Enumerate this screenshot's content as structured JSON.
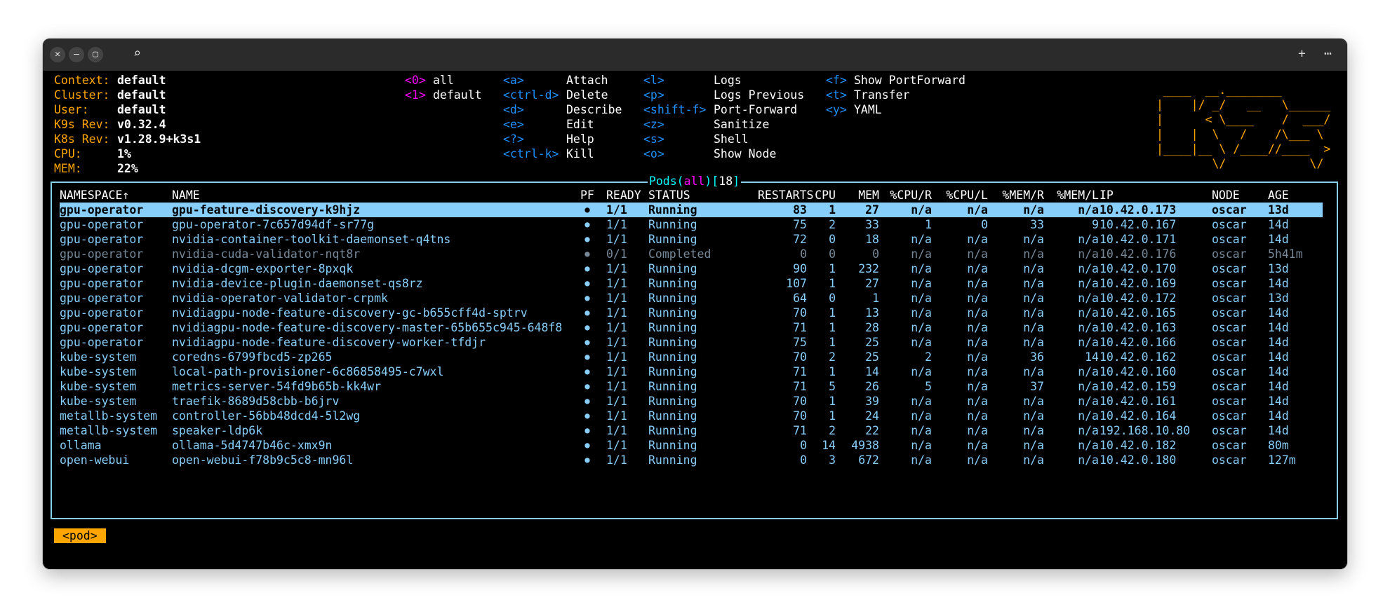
{
  "titlebar": {
    "close_icon": "close-icon",
    "minimize_icon": "minimize-icon",
    "maximize_icon": "maximize-icon",
    "search_icon": "search-icon",
    "new_tab_icon": "plus-icon",
    "menu_icon": "more-icon"
  },
  "info": [
    {
      "label": "Context:",
      "value": "default"
    },
    {
      "label": "Cluster:",
      "value": "default"
    },
    {
      "label": "User:",
      "value": "default"
    },
    {
      "label": "K9s Rev:",
      "value": "v0.32.4"
    },
    {
      "label": "K8s Rev:",
      "value": "v1.28.9+k3s1"
    },
    {
      "label": "CPU:",
      "value": "1%"
    },
    {
      "label": "MEM:",
      "value": "22%"
    }
  ],
  "namespaces": [
    {
      "key": "<0>",
      "label": "all"
    },
    {
      "key": "<1>",
      "label": "default"
    }
  ],
  "hotkeys_col1": [
    {
      "key": "<a>",
      "label": "Attach"
    },
    {
      "key": "<ctrl-d>",
      "label": "Delete"
    },
    {
      "key": "<d>",
      "label": "Describe"
    },
    {
      "key": "<e>",
      "label": "Edit"
    },
    {
      "key": "<?>",
      "label": "Help"
    },
    {
      "key": "<ctrl-k>",
      "label": "Kill"
    }
  ],
  "hotkeys_col2": [
    {
      "key": "<l>",
      "label": "Logs"
    },
    {
      "key": "<p>",
      "label": "Logs Previous"
    },
    {
      "key": "<shift-f>",
      "label": "Port-Forward"
    },
    {
      "key": "<z>",
      "label": "Sanitize"
    },
    {
      "key": "<s>",
      "label": "Shell"
    },
    {
      "key": "<o>",
      "label": "Show Node"
    }
  ],
  "hotkeys_col3": [
    {
      "key": "<f>",
      "label": "Show PortForward"
    },
    {
      "key": "<t>",
      "label": "Transfer"
    },
    {
      "key": "<y>",
      "label": "YAML"
    }
  ],
  "logo_lines": [
    " ____  __.________        ",
    "|    |/ _/   __   \\______ ",
    "|      < \\____    /  ___/ ",
    "|    |  \\   /    /\\___ \\  ",
    "|____|__ \\ /____//____  > ",
    "        \\/            \\/  "
  ],
  "pods": {
    "title_resource": "Pods",
    "title_namespace": "all",
    "title_count": "18",
    "columns": [
      "NAMESPACE↑",
      "NAME",
      "PF",
      "READY",
      "STATUS",
      "RESTARTS",
      "CPU",
      "MEM",
      "%CPU/R",
      "%CPU/L",
      "%MEM/R",
      "%MEM/L",
      "IP",
      "NODE",
      "AGE"
    ],
    "rows": [
      [
        "gpu-operator",
        "gpu-feature-discovery-k9hjz",
        "●",
        "1/1",
        "Running",
        "83",
        "1",
        "27",
        "n/a",
        "n/a",
        "n/a",
        "n/a",
        "10.42.0.173",
        "oscar",
        "13d"
      ],
      [
        "gpu-operator",
        "gpu-operator-7c657d94df-sr77g",
        "●",
        "1/1",
        "Running",
        "75",
        "2",
        "33",
        "1",
        "0",
        "33",
        "9",
        "10.42.0.167",
        "oscar",
        "14d"
      ],
      [
        "gpu-operator",
        "nvidia-container-toolkit-daemonset-q4tns",
        "●",
        "1/1",
        "Running",
        "72",
        "0",
        "18",
        "n/a",
        "n/a",
        "n/a",
        "n/a",
        "10.42.0.171",
        "oscar",
        "14d"
      ],
      [
        "gpu-operator",
        "nvidia-cuda-validator-nqt8r",
        "●",
        "0/1",
        "Completed",
        "0",
        "0",
        "0",
        "n/a",
        "n/a",
        "n/a",
        "n/a",
        "10.42.0.176",
        "oscar",
        "5h41m"
      ],
      [
        "gpu-operator",
        "nvidia-dcgm-exporter-8pxqk",
        "●",
        "1/1",
        "Running",
        "90",
        "1",
        "232",
        "n/a",
        "n/a",
        "n/a",
        "n/a",
        "10.42.0.170",
        "oscar",
        "13d"
      ],
      [
        "gpu-operator",
        "nvidia-device-plugin-daemonset-qs8rz",
        "●",
        "1/1",
        "Running",
        "107",
        "1",
        "27",
        "n/a",
        "n/a",
        "n/a",
        "n/a",
        "10.42.0.169",
        "oscar",
        "14d"
      ],
      [
        "gpu-operator",
        "nvidia-operator-validator-crpmk",
        "●",
        "1/1",
        "Running",
        "64",
        "0",
        "1",
        "n/a",
        "n/a",
        "n/a",
        "n/a",
        "10.42.0.172",
        "oscar",
        "13d"
      ],
      [
        "gpu-operator",
        "nvidiagpu-node-feature-discovery-gc-b655cff4d-sptrv",
        "●",
        "1/1",
        "Running",
        "70",
        "1",
        "13",
        "n/a",
        "n/a",
        "n/a",
        "n/a",
        "10.42.0.165",
        "oscar",
        "14d"
      ],
      [
        "gpu-operator",
        "nvidiagpu-node-feature-discovery-master-65b655c945-648f8",
        "●",
        "1/1",
        "Running",
        "71",
        "1",
        "28",
        "n/a",
        "n/a",
        "n/a",
        "n/a",
        "10.42.0.163",
        "oscar",
        "14d"
      ],
      [
        "gpu-operator",
        "nvidiagpu-node-feature-discovery-worker-tfdjr",
        "●",
        "1/1",
        "Running",
        "75",
        "1",
        "25",
        "n/a",
        "n/a",
        "n/a",
        "n/a",
        "10.42.0.166",
        "oscar",
        "14d"
      ],
      [
        "kube-system",
        "coredns-6799fbcd5-zp265",
        "●",
        "1/1",
        "Running",
        "70",
        "2",
        "25",
        "2",
        "n/a",
        "36",
        "14",
        "10.42.0.162",
        "oscar",
        "14d"
      ],
      [
        "kube-system",
        "local-path-provisioner-6c86858495-c7wxl",
        "●",
        "1/1",
        "Running",
        "71",
        "1",
        "14",
        "n/a",
        "n/a",
        "n/a",
        "n/a",
        "10.42.0.160",
        "oscar",
        "14d"
      ],
      [
        "kube-system",
        "metrics-server-54fd9b65b-kk4wr",
        "●",
        "1/1",
        "Running",
        "71",
        "5",
        "26",
        "5",
        "n/a",
        "37",
        "n/a",
        "10.42.0.159",
        "oscar",
        "14d"
      ],
      [
        "kube-system",
        "traefik-8689d58cbb-b6jrv",
        "●",
        "1/1",
        "Running",
        "70",
        "1",
        "39",
        "n/a",
        "n/a",
        "n/a",
        "n/a",
        "10.42.0.161",
        "oscar",
        "14d"
      ],
      [
        "metallb-system",
        "controller-56bb48dcd4-5l2wg",
        "●",
        "1/1",
        "Running",
        "70",
        "1",
        "24",
        "n/a",
        "n/a",
        "n/a",
        "n/a",
        "10.42.0.164",
        "oscar",
        "14d"
      ],
      [
        "metallb-system",
        "speaker-ldp6k",
        "●",
        "1/1",
        "Running",
        "71",
        "2",
        "22",
        "n/a",
        "n/a",
        "n/a",
        "n/a",
        "192.168.10.80",
        "oscar",
        "14d"
      ],
      [
        "ollama",
        "ollama-5d4747b46c-xmx9n",
        "●",
        "1/1",
        "Running",
        "0",
        "14",
        "4938",
        "n/a",
        "n/a",
        "n/a",
        "n/a",
        "10.42.0.182",
        "oscar",
        "80m"
      ],
      [
        "open-webui",
        "open-webui-f78b9c5c8-mn96l",
        "●",
        "1/1",
        "Running",
        "0",
        "3",
        "672",
        "n/a",
        "n/a",
        "n/a",
        "n/a",
        "10.42.0.180",
        "oscar",
        "127m"
      ]
    ],
    "selected_row": 0,
    "completed_row": 3
  },
  "breadcrumb": "<pod>",
  "colors": {
    "orange": "#ffa500",
    "row_text": "#87cefa",
    "completed_text": "#778899",
    "selected_bg": "#87cefa",
    "border": "#87ceeb",
    "key_blue": "#1e90ff",
    "magenta": "#ff00ff",
    "aqua": "#00ffff"
  }
}
